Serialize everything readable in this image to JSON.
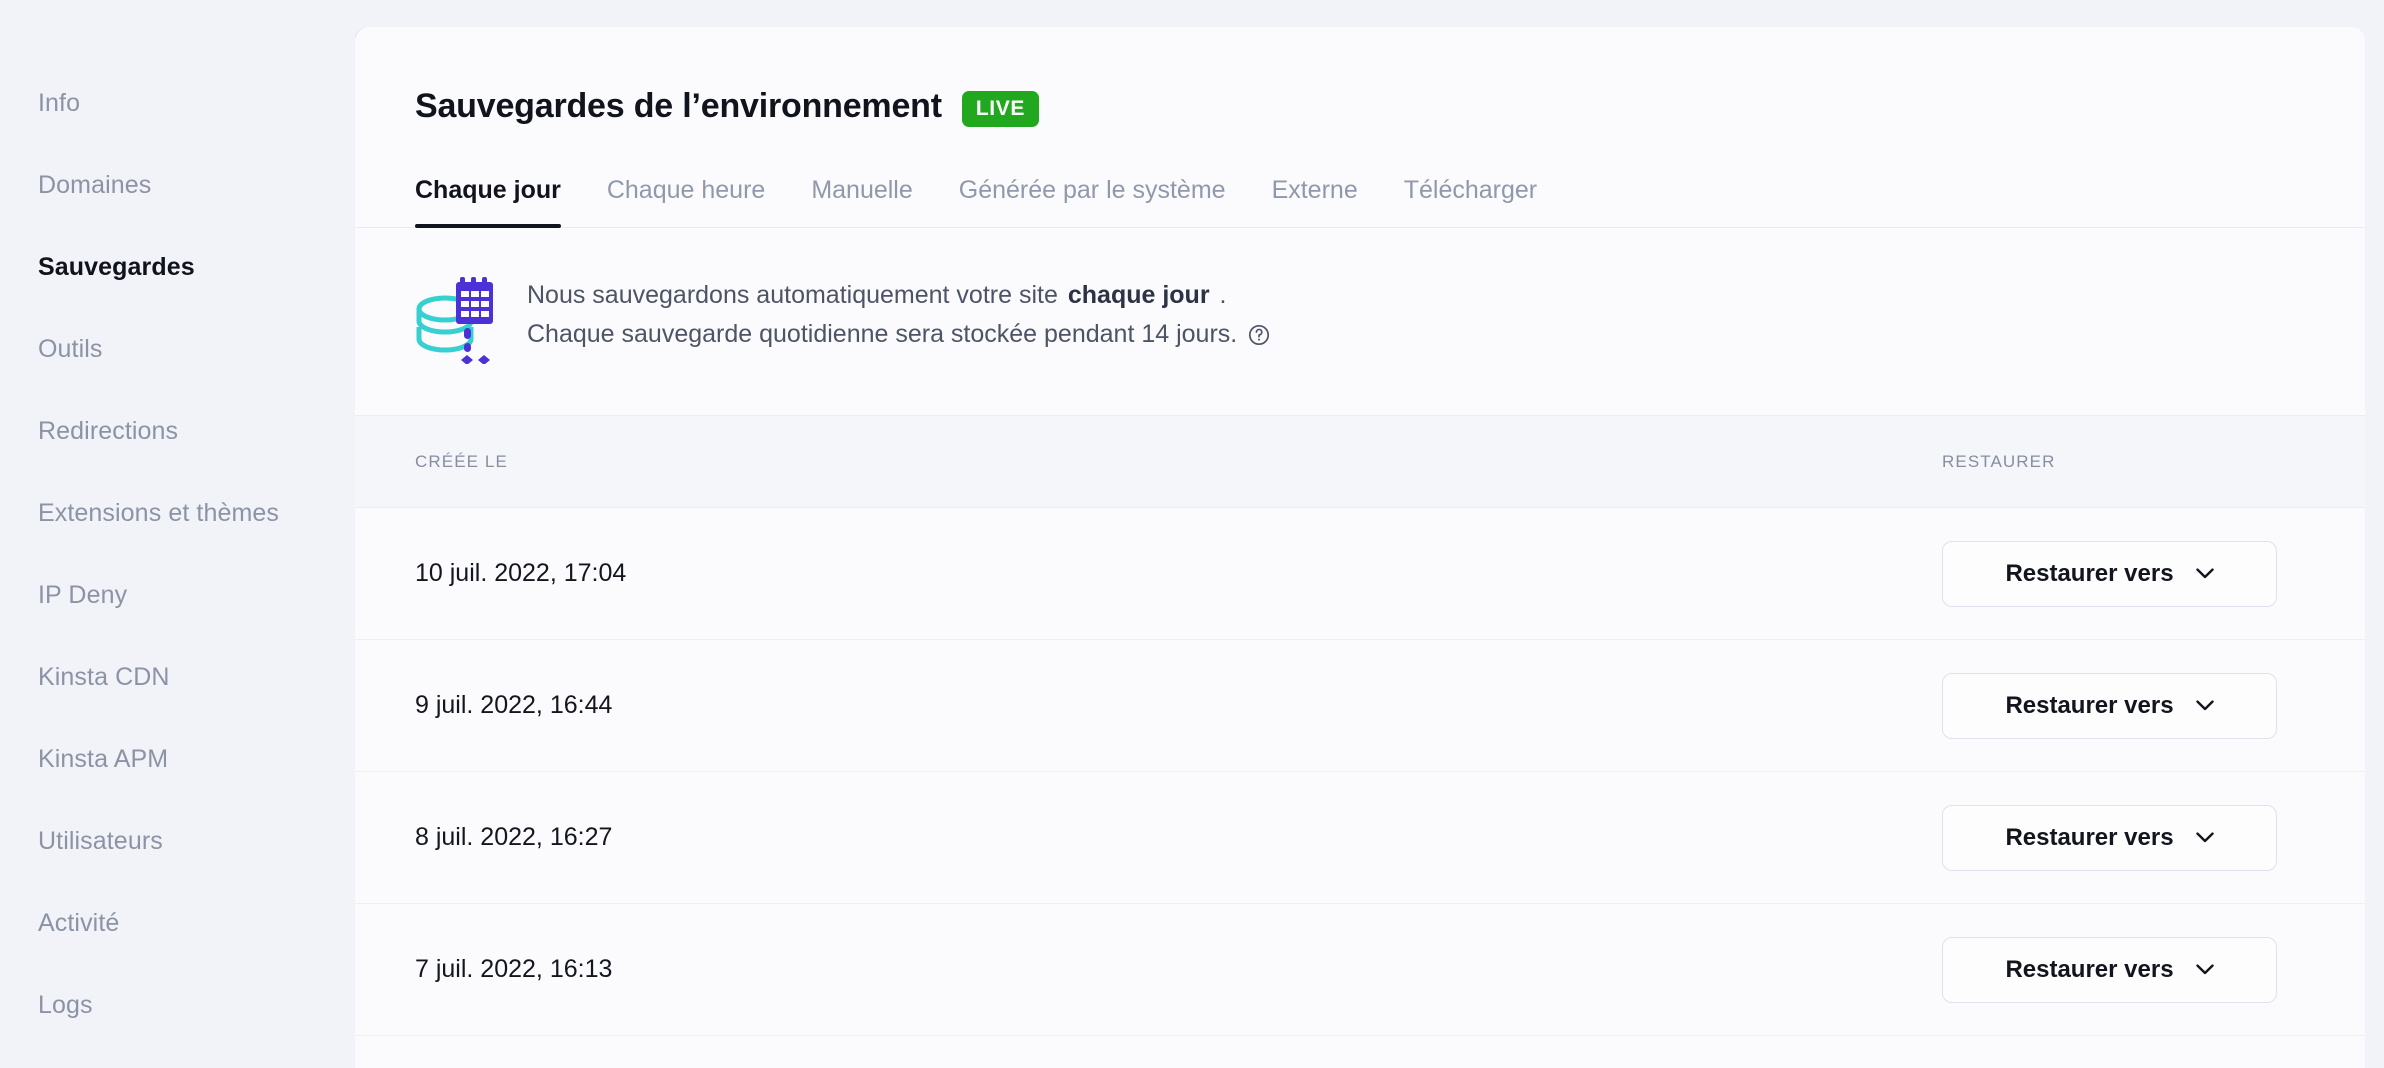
{
  "sidebar": {
    "items": [
      {
        "label": "Info",
        "active": false
      },
      {
        "label": "Domaines",
        "active": false
      },
      {
        "label": "Sauvegardes",
        "active": true
      },
      {
        "label": "Outils",
        "active": false
      },
      {
        "label": "Redirections",
        "active": false
      },
      {
        "label": "Extensions et thèmes",
        "active": false
      },
      {
        "label": "IP Deny",
        "active": false
      },
      {
        "label": "Kinsta CDN",
        "active": false
      },
      {
        "label": "Kinsta APM",
        "active": false
      },
      {
        "label": "Utilisateurs",
        "active": false
      },
      {
        "label": "Activité",
        "active": false
      },
      {
        "label": "Logs",
        "active": false
      }
    ]
  },
  "header": {
    "title": "Sauvegardes de l’environnement",
    "badge": "LIVE",
    "badge_color": "#22a81e"
  },
  "tabs": [
    {
      "label": "Chaque jour",
      "active": true
    },
    {
      "label": "Chaque heure",
      "active": false
    },
    {
      "label": "Manuelle",
      "active": false
    },
    {
      "label": "Générée par le système",
      "active": false
    },
    {
      "label": "Externe",
      "active": false
    },
    {
      "label": "Télécharger",
      "active": false
    }
  ],
  "banner": {
    "icon": "database-calendar-illustration",
    "line1_prefix": "Nous sauvegardons automatiquement votre site ",
    "line1_strong": "chaque jour",
    "line1_suffix": ".",
    "line2": "Chaque sauvegarde quotidienne sera stockée pendant 14 jours.",
    "help_icon": "help-circle-icon"
  },
  "table": {
    "columns": {
      "created": "CRÉÉE LE",
      "restore": "RESTAURER"
    },
    "restore_button_label": "Restaurer vers",
    "rows": [
      {
        "created": "10 juil. 2022, 17:04"
      },
      {
        "created": "9 juil. 2022, 16:44"
      },
      {
        "created": "8 juil. 2022, 16:27"
      },
      {
        "created": "7 juil. 2022, 16:13"
      }
    ]
  }
}
